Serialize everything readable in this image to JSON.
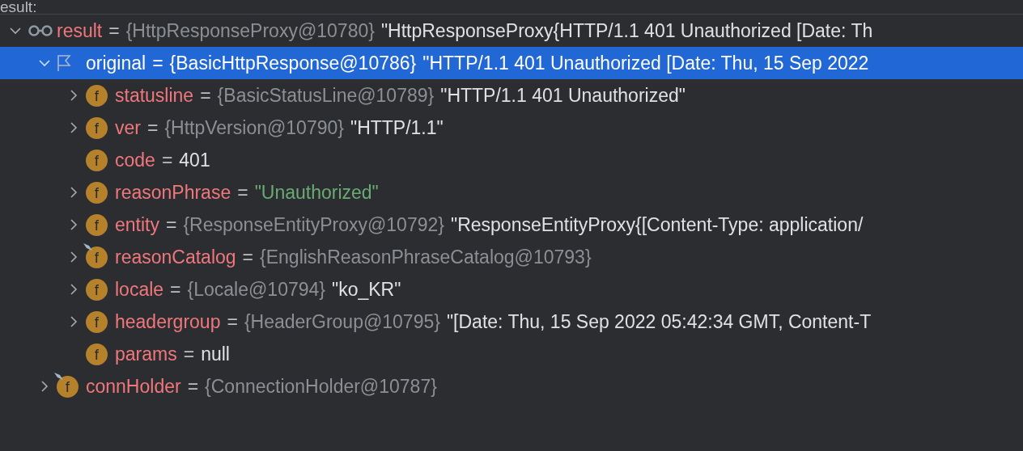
{
  "header": {
    "label": "esult:"
  },
  "tree": [
    {
      "kind": "watch",
      "expanded": true,
      "selected": false,
      "name": "result",
      "eq": "=",
      "type": "{HttpResponseProxy@10780}",
      "value": {
        "kind": "text",
        "text": "\"HttpResponseProxy{HTTP/1.1 401 Unauthorized [Date: Th"
      },
      "children": [
        {
          "kind": "flag",
          "expanded": true,
          "selected": true,
          "name": "original",
          "eq": "=",
          "type": "{BasicHttpResponse@10786}",
          "value": {
            "kind": "text",
            "text": "\"HTTP/1.1 401 Unauthorized [Date: Thu, 15 Sep 2022"
          },
          "children": [
            {
              "kind": "field",
              "icon_letter": "f",
              "pinned": false,
              "expanded": false,
              "selected": false,
              "name": "statusline",
              "eq": "=",
              "type": "{BasicStatusLine@10789}",
              "value": {
                "kind": "text",
                "text": "\"HTTP/1.1 401 Unauthorized\""
              }
            },
            {
              "kind": "field",
              "icon_letter": "f",
              "pinned": false,
              "expanded": false,
              "selected": false,
              "name": "ver",
              "eq": "=",
              "type": "{HttpVersion@10790}",
              "value": {
                "kind": "text",
                "text": "\"HTTP/1.1\""
              }
            },
            {
              "kind": "field",
              "icon_letter": "f",
              "pinned": false,
              "selected": false,
              "name": "code",
              "eq": "=",
              "value": {
                "kind": "text",
                "text": "401"
              }
            },
            {
              "kind": "field",
              "icon_letter": "f",
              "pinned": false,
              "expanded": false,
              "selected": false,
              "name": "reasonPhrase",
              "eq": "=",
              "value": {
                "kind": "string",
                "text": "\"Unauthorized\""
              }
            },
            {
              "kind": "field",
              "icon_letter": "f",
              "pinned": false,
              "expanded": false,
              "selected": false,
              "name": "entity",
              "eq": "=",
              "type": "{ResponseEntityProxy@10792}",
              "value": {
                "kind": "text",
                "text": "\"ResponseEntityProxy{[Content-Type: application/"
              }
            },
            {
              "kind": "field",
              "icon_letter": "f",
              "pinned": true,
              "expanded": false,
              "selected": false,
              "name": "reasonCatalog",
              "eq": "=",
              "type": "{EnglishReasonPhraseCatalog@10793}"
            },
            {
              "kind": "field",
              "icon_letter": "f",
              "pinned": false,
              "expanded": false,
              "selected": false,
              "name": "locale",
              "eq": "=",
              "type": "{Locale@10794}",
              "value": {
                "kind": "text",
                "text": "\"ko_KR\""
              }
            },
            {
              "kind": "field",
              "icon_letter": "f",
              "pinned": false,
              "expanded": false,
              "selected": false,
              "name": "headergroup",
              "eq": "=",
              "type": "{HeaderGroup@10795}",
              "value": {
                "kind": "text",
                "text": "\"[Date: Thu, 15 Sep 2022 05:42:34 GMT, Content-T"
              }
            },
            {
              "kind": "field",
              "icon_letter": "f",
              "pinned": false,
              "selected": false,
              "name": "params",
              "eq": "=",
              "value": {
                "kind": "text",
                "text": "null"
              }
            }
          ]
        },
        {
          "kind": "field",
          "icon_letter": "f",
          "pinned": true,
          "expanded": false,
          "selected": false,
          "name": "connHolder",
          "eq": "=",
          "type": "{ConnectionHolder@10787}"
        }
      ]
    }
  ]
}
